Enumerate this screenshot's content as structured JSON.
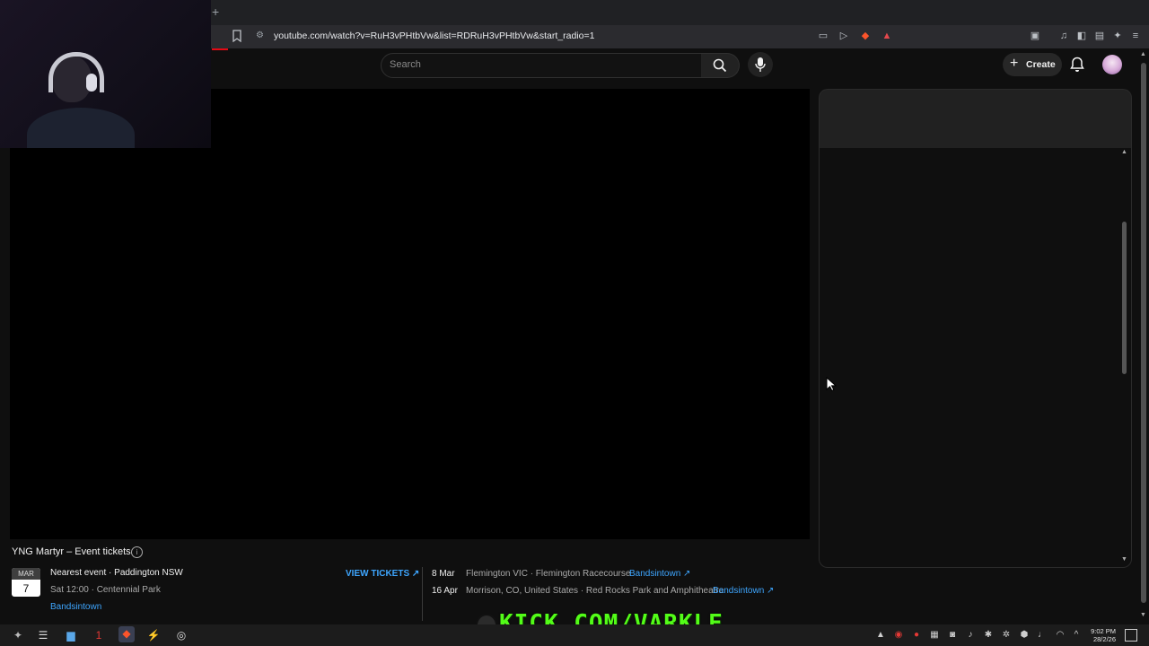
{
  "browser": {
    "url": "youtube.com/watch?v=RuH3vPHtbVw&list=RDRuH3vPHtbVw&start_radio=1",
    "new_tab_glyph": "+"
  },
  "header": {
    "search_placeholder": "Search",
    "create_label": "Create"
  },
  "tickets": {
    "title": "YNG Martyr – Event tickets",
    "nearest": {
      "month": "MAR",
      "day": "7",
      "line1": "Nearest event · Paddington NSW",
      "line2": "Sat 12:00 · Centennial Park",
      "source": "Bandsintown"
    },
    "view_tickets_label": "VIEW TICKETS ↗",
    "events": [
      {
        "date": "8 Mar",
        "venue": "Flemington VIC · Flemington Racecourse",
        "source": "Bandsintown ↗"
      },
      {
        "date": "16 Apr",
        "venue": "Morrison, CO, United States · Red Rocks Park and Amphitheatre",
        "source": "Bandsintown ↗"
      }
    ]
  },
  "overlay": {
    "kick_text": "KICK.COM/VARKLE"
  },
  "taskbar": {
    "time": "9:02 PM",
    "date": "28/2/26"
  },
  "colors": {
    "accent_link": "#3ea6ff",
    "kick_green": "#53fc18",
    "brand_red": "#e50914"
  }
}
